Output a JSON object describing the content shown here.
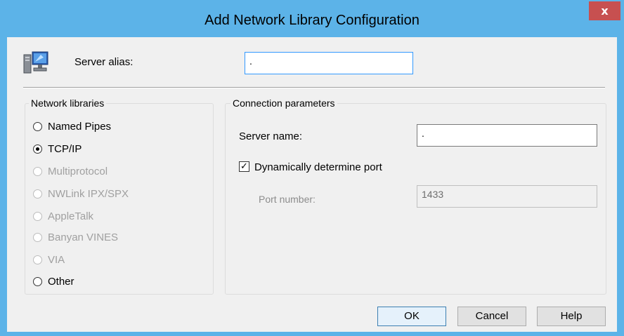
{
  "window": {
    "title": "Add Network Library Configuration",
    "close_glyph": "x",
    "accent_color": "#5cb3e8"
  },
  "server_alias": {
    "label": "Server alias:",
    "value": "."
  },
  "network_libraries": {
    "title": "Network libraries",
    "options": [
      {
        "label": "Named Pipes",
        "checked": false,
        "enabled": true
      },
      {
        "label": "TCP/IP",
        "checked": true,
        "enabled": true
      },
      {
        "label": "Multiprotocol",
        "checked": false,
        "enabled": false
      },
      {
        "label": "NWLink IPX/SPX",
        "checked": false,
        "enabled": false
      },
      {
        "label": "AppleTalk",
        "checked": false,
        "enabled": false
      },
      {
        "label": "Banyan VINES",
        "checked": false,
        "enabled": false
      },
      {
        "label": "VIA",
        "checked": false,
        "enabled": false
      },
      {
        "label": "Other",
        "checked": false,
        "enabled": true
      }
    ]
  },
  "connection_parameters": {
    "title": "Connection parameters",
    "server_name_label": "Server name:",
    "server_name_value": ".",
    "dynamic_port_label": "Dynamically determine port",
    "dynamic_port_checked": true,
    "check_glyph": "✓",
    "port_number_label": "Port number:",
    "port_number_value": "1433"
  },
  "buttons": {
    "ok": "OK",
    "cancel": "Cancel",
    "help": "Help"
  }
}
